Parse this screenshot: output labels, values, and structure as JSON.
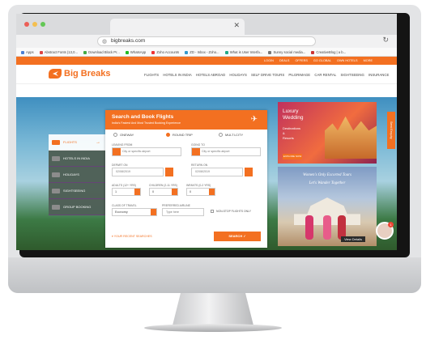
{
  "browser": {
    "address": "bigbreaks.com",
    "bookmarks": [
      "Apps",
      "Abstract Fonts (13,0...",
      "Download Block Pr...",
      "WhatsApp",
      "Zoho Accounts",
      "ZD - Inbox - Zoho...",
      "What is User Interfa...",
      "Sunny social media...",
      "CreativeBlog | a b..."
    ]
  },
  "site": {
    "logo_text": "Big Breaks",
    "top_links": [
      "LOGIN",
      "DEALS",
      "OFFERS",
      "GO GLOBAL",
      "OWN HOTELS",
      "MORE"
    ],
    "nav": [
      "FLIGHTS",
      "HOTELS IN INDIA",
      "HOTELS ABROAD",
      "HOLIDAYS",
      "SELF DRIVE TOURS",
      "PILGRIMAGE",
      "CAR RENTAL",
      "SIGHTSEEING",
      "INSURANCE"
    ],
    "side_tabs": [
      "FLIGHTS",
      "HOTELS IN INDIA",
      "HOLIDAYS",
      "SIGHTSEEING",
      "GROUP BOOKING"
    ],
    "form": {
      "title": "Search and Book Flights",
      "subtitle": "India's Fastest And Most Trusted Booking Experience",
      "trip_types": [
        "ONEWAY",
        "ROUND TRIP",
        "MULTI-CITY"
      ],
      "leaving_from_label": "LEAVING FROM",
      "leaving_from_placeholder": "City or specific airport",
      "going_to_label": "GOING TO",
      "going_to_placeholder": "City or specific airport",
      "depart_label": "DEPART ON",
      "depart_value": "02/08/2019",
      "return_label": "RETURN ON",
      "return_value": "02/08/2019",
      "adults_label": "ADULTS (12+ YRS)",
      "adults_value": "1",
      "children_label": "CHILDREN (2-11 YRS)",
      "children_value": "0",
      "infants_label": "INFANTS (0-2 YRS)",
      "infants_value": "0",
      "class_label": "CLASS OF TRAVEL",
      "class_value": "Economy",
      "airline_label": "PREFERRED AIRLINE",
      "airline_placeholder": "Type here",
      "nonstop_label": "NON-STOP FLIGHTS ONLY",
      "recent_label": "YOUR RECENT SEARCHES",
      "search_label": "SEARCH"
    },
    "ads": {
      "wedding_lines": [
        "Luxury",
        "Wedding"
      ],
      "wedding_sub": [
        "Destinations",
        "&",
        "Resorts"
      ],
      "explore": "EXPLORE NOW",
      "women_title": "Women's Only Escorted Tours",
      "women_sub": "Let's Wander Together",
      "view_details": "View Details"
    },
    "enquiry": "Send Enquiry",
    "chat_count": "1"
  }
}
